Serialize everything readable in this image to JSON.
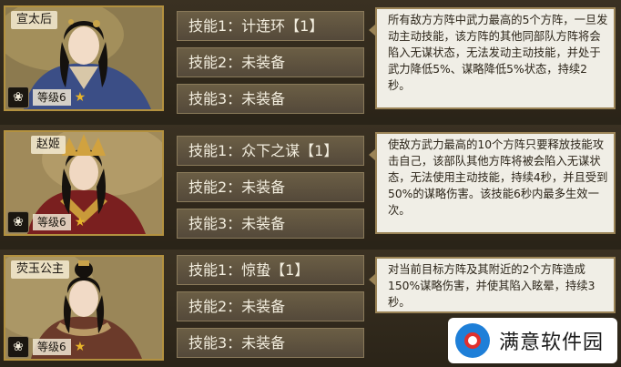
{
  "heroes": [
    {
      "name": "宣太后",
      "level": "等级6",
      "skills": [
        "技能1：计连环【1】",
        "技能2：未装备",
        "技能3：未装备"
      ],
      "description": "所有敌方方阵中武力最高的5个方阵，一旦发动主动技能，该方阵的其他同部队方阵将会陷入无谋状态，无法发动主动技能，并处于武力降低5%、谋略降低5%状态，持续2秒。",
      "robe_color": "#3b4e86",
      "accent_color": "#7a6a45"
    },
    {
      "name": "赵姬",
      "level": "等级6",
      "skills": [
        "技能1：众下之谋【1】",
        "技能2：未装备",
        "技能3：未装备"
      ],
      "description": "使敌方武力最高的10个方阵只要释放技能攻击自己，该部队其他方阵将被会陷入无谋状态，无法使用主动技能，持续4秒，并且受到50%的谋略伤害。该技能6秒内最多生效一次。",
      "robe_color": "#7a1f1f",
      "accent_color": "#c99a3a"
    },
    {
      "name": "荧玉公主",
      "level": "等级6",
      "skills": [
        "技能1：惊蛰【1】",
        "技能2：未装备",
        "技能3：未装备"
      ],
      "description": "对当前目标方阵及其附近的2个方阵造成150%谋略伤害，并使其陷入眩晕，持续3秒。",
      "robe_color": "#6b3a2a",
      "accent_color": "#b99a66"
    }
  ],
  "watermark": {
    "text": "满意软件园"
  },
  "icons": {
    "lotus": "lotus-icon",
    "star": "star-icon",
    "logo": "satisfaction-logo-icon"
  }
}
